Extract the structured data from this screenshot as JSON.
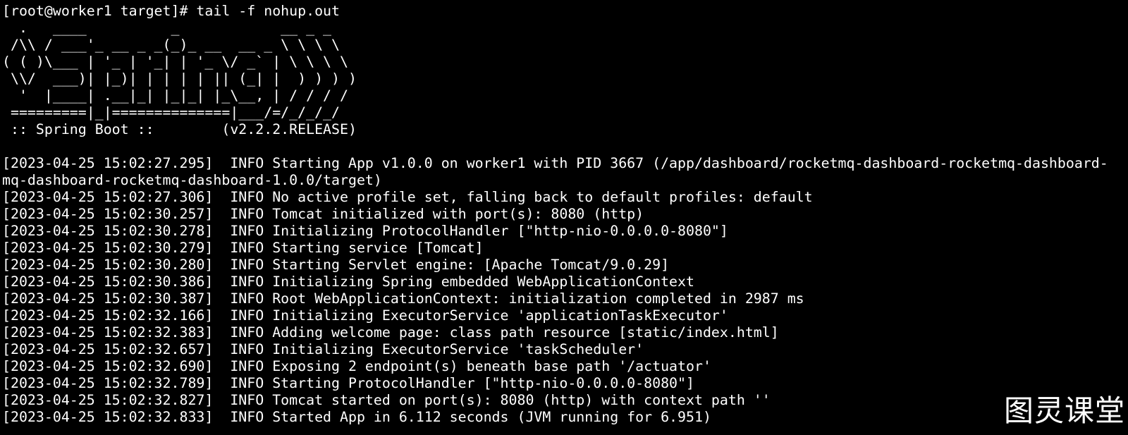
{
  "terminal": {
    "background": "#000000",
    "foreground": "#ffffff",
    "prompt_line": "[root@worker1 target]# tail -f nohup.out",
    "banner": [
      "  .   ____          _            __ _ _",
      " /\\\\ / ___'_ __ _ _(_)_ __  __ _ \\ \\ \\ \\",
      "( ( )\\___ | '_ | '_| | '_ \\/ _` | \\ \\ \\ \\",
      " \\\\/  ___)| |_)| | | | | || (_| |  ) ) ) )",
      "  '  |____| .__|_| |_|_| |_\\__, | / / / /",
      " =========|_|==============|___/=/_/_/_/",
      " :: Spring Boot ::        (v2.2.2.RELEASE)"
    ],
    "log_lines": [
      "[2023-04-25 15:02:27.295]  INFO Starting App v1.0.0 on worker1 with PID 3667 (/app/dashboard/rocketmq-dashboard-rocketmq-dashboard-",
      "mq-dashboard-rocketmq-dashboard-1.0.0/target)",
      "[2023-04-25 15:02:27.306]  INFO No active profile set, falling back to default profiles: default",
      "[2023-04-25 15:02:30.257]  INFO Tomcat initialized with port(s): 8080 (http)",
      "[2023-04-25 15:02:30.278]  INFO Initializing ProtocolHandler [\"http-nio-0.0.0.0-8080\"]",
      "[2023-04-25 15:02:30.279]  INFO Starting service [Tomcat]",
      "[2023-04-25 15:02:30.280]  INFO Starting Servlet engine: [Apache Tomcat/9.0.29]",
      "[2023-04-25 15:02:30.386]  INFO Initializing Spring embedded WebApplicationContext",
      "[2023-04-25 15:02:30.387]  INFO Root WebApplicationContext: initialization completed in 2987 ms",
      "[2023-04-25 15:02:32.166]  INFO Initializing ExecutorService 'applicationTaskExecutor'",
      "[2023-04-25 15:02:32.383]  INFO Adding welcome page: class path resource [static/index.html]",
      "[2023-04-25 15:02:32.657]  INFO Initializing ExecutorService 'taskScheduler'",
      "[2023-04-25 15:02:32.690]  INFO Exposing 2 endpoint(s) beneath base path '/actuator'",
      "[2023-04-25 15:02:32.789]  INFO Starting ProtocolHandler [\"http-nio-0.0.0.0-8080\"]",
      "[2023-04-25 15:02:32.827]  INFO Tomcat started on port(s): 8080 (http) with context path ''",
      "[2023-04-25 15:02:32.833]  INFO Started App in 6.112 seconds (JVM running for 6.951)"
    ]
  },
  "watermark": {
    "text": "图灵课堂"
  }
}
